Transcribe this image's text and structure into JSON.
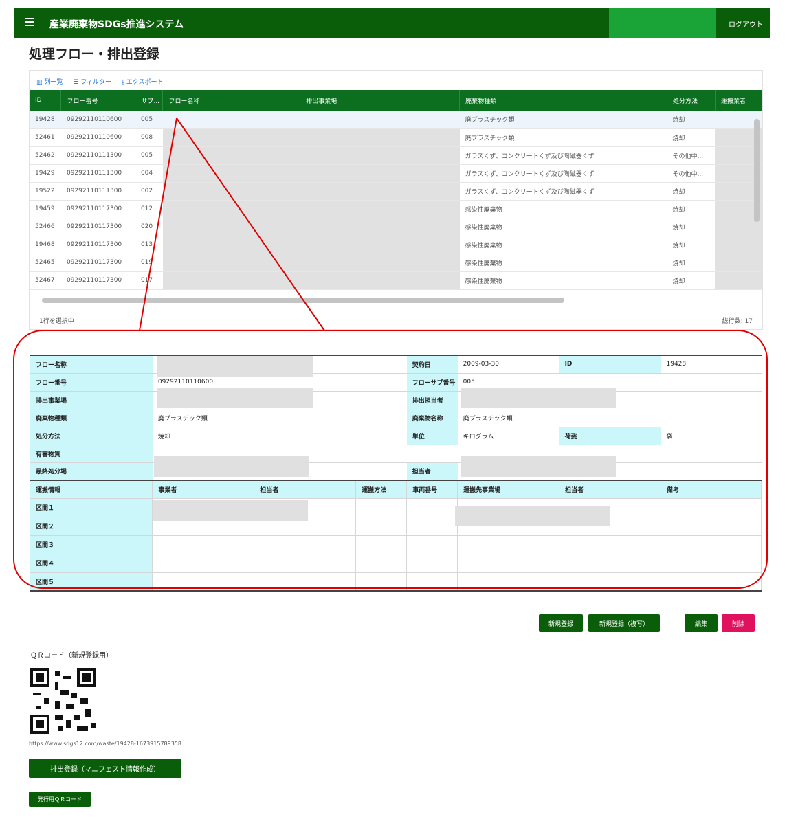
{
  "header": {
    "menu_icon": "hamburger-menu-icon",
    "title": "産業廃棄物SDGs推進システム",
    "logout": "ログアウト",
    "colors": {
      "bar": "#0a5e0a",
      "accent": "#1aa336"
    }
  },
  "page_title": "処理フロー・排出登録",
  "grid": {
    "toolbar": {
      "columns": "列一覧",
      "filter": "フィルター",
      "export": "エクスポート"
    },
    "columns": [
      "ID",
      "フロー番号",
      "サブ...",
      "フロー名称",
      "排出事業場",
      "廃棄物種類",
      "処分方法",
      "運搬業者"
    ],
    "rows": [
      {
        "id": "19428",
        "flow_no": "09292110110600",
        "sub": "005",
        "type": "廃プラスチック類",
        "method": "焼却"
      },
      {
        "id": "52461",
        "flow_no": "09292110110600",
        "sub": "008",
        "type": "廃プラスチック類",
        "method": "焼却"
      },
      {
        "id": "52462",
        "flow_no": "09292110111300",
        "sub": "005",
        "type": "ガラスくず、コンクリートくず及び陶磁器くず",
        "method": "その他中..."
      },
      {
        "id": "19429",
        "flow_no": "09292110111300",
        "sub": "004",
        "type": "ガラスくず、コンクリートくず及び陶磁器くず",
        "method": "その他中..."
      },
      {
        "id": "19522",
        "flow_no": "09292110111300",
        "sub": "002",
        "type": "ガラスくず、コンクリートくず及び陶磁器くず",
        "method": "焼却"
      },
      {
        "id": "19459",
        "flow_no": "09292110117300",
        "sub": "012",
        "type": "感染性廃棄物",
        "method": "焼却"
      },
      {
        "id": "52466",
        "flow_no": "09292110117300",
        "sub": "020",
        "type": "感染性廃棄物",
        "method": "焼却"
      },
      {
        "id": "19468",
        "flow_no": "09292110117300",
        "sub": "013",
        "type": "感染性廃棄物",
        "method": "焼却"
      },
      {
        "id": "52465",
        "flow_no": "09292110117300",
        "sub": "019",
        "type": "感染性廃棄物",
        "method": "焼却"
      },
      {
        "id": "52467",
        "flow_no": "09292110117300",
        "sub": "017",
        "type": "感染性廃棄物",
        "method": "焼却"
      }
    ],
    "selected_text": "1行を選択中",
    "total_text": "総行数: 17"
  },
  "detail": {
    "flow_name_label": "フロー名称",
    "contract_date_label": "契約日",
    "contract_date": "2009-03-30",
    "id_label": "ID",
    "id_value": "19428",
    "flow_no_label": "フロー番号",
    "flow_no": "09292110110600",
    "flow_sub_label": "フローサブ番号",
    "flow_sub": "005",
    "emitter_site_label": "排出事業場",
    "emitter_person_label": "排出担当者",
    "waste_type_label": "廃棄物種類",
    "waste_type": "廃プラスチック類",
    "waste_name_label": "廃棄物名称",
    "waste_name": "廃プラスチック類",
    "method_label": "処分方法",
    "method": "焼却",
    "unit_label": "単位",
    "unit": "キログラム",
    "hazard_label": "荷姿",
    "hazard_value": "袋",
    "toxic_label": "有害物質",
    "final_site_label": "最終処分場",
    "person_label": "担当者",
    "transport": {
      "headers": [
        "運搬情報",
        "事業者",
        "担当者",
        "運搬方法",
        "車両番号",
        "運搬先事業場",
        "担当者",
        "備考"
      ],
      "sections": [
        "区間１",
        "区間２",
        "区間３",
        "区間４",
        "区間５"
      ]
    }
  },
  "buttons": {
    "new": "新規登録",
    "new_copy": "新規登録（複写）",
    "edit": "編集",
    "delete": "削除",
    "emit": "排出登録（マニフェスト情報作成）",
    "qr_print": "発行用ＱＲコード"
  },
  "qr": {
    "label": "ＱＲコード（新規登録用）",
    "url": "https://www.sdgs12.com/waste/19428-1673915789358"
  }
}
